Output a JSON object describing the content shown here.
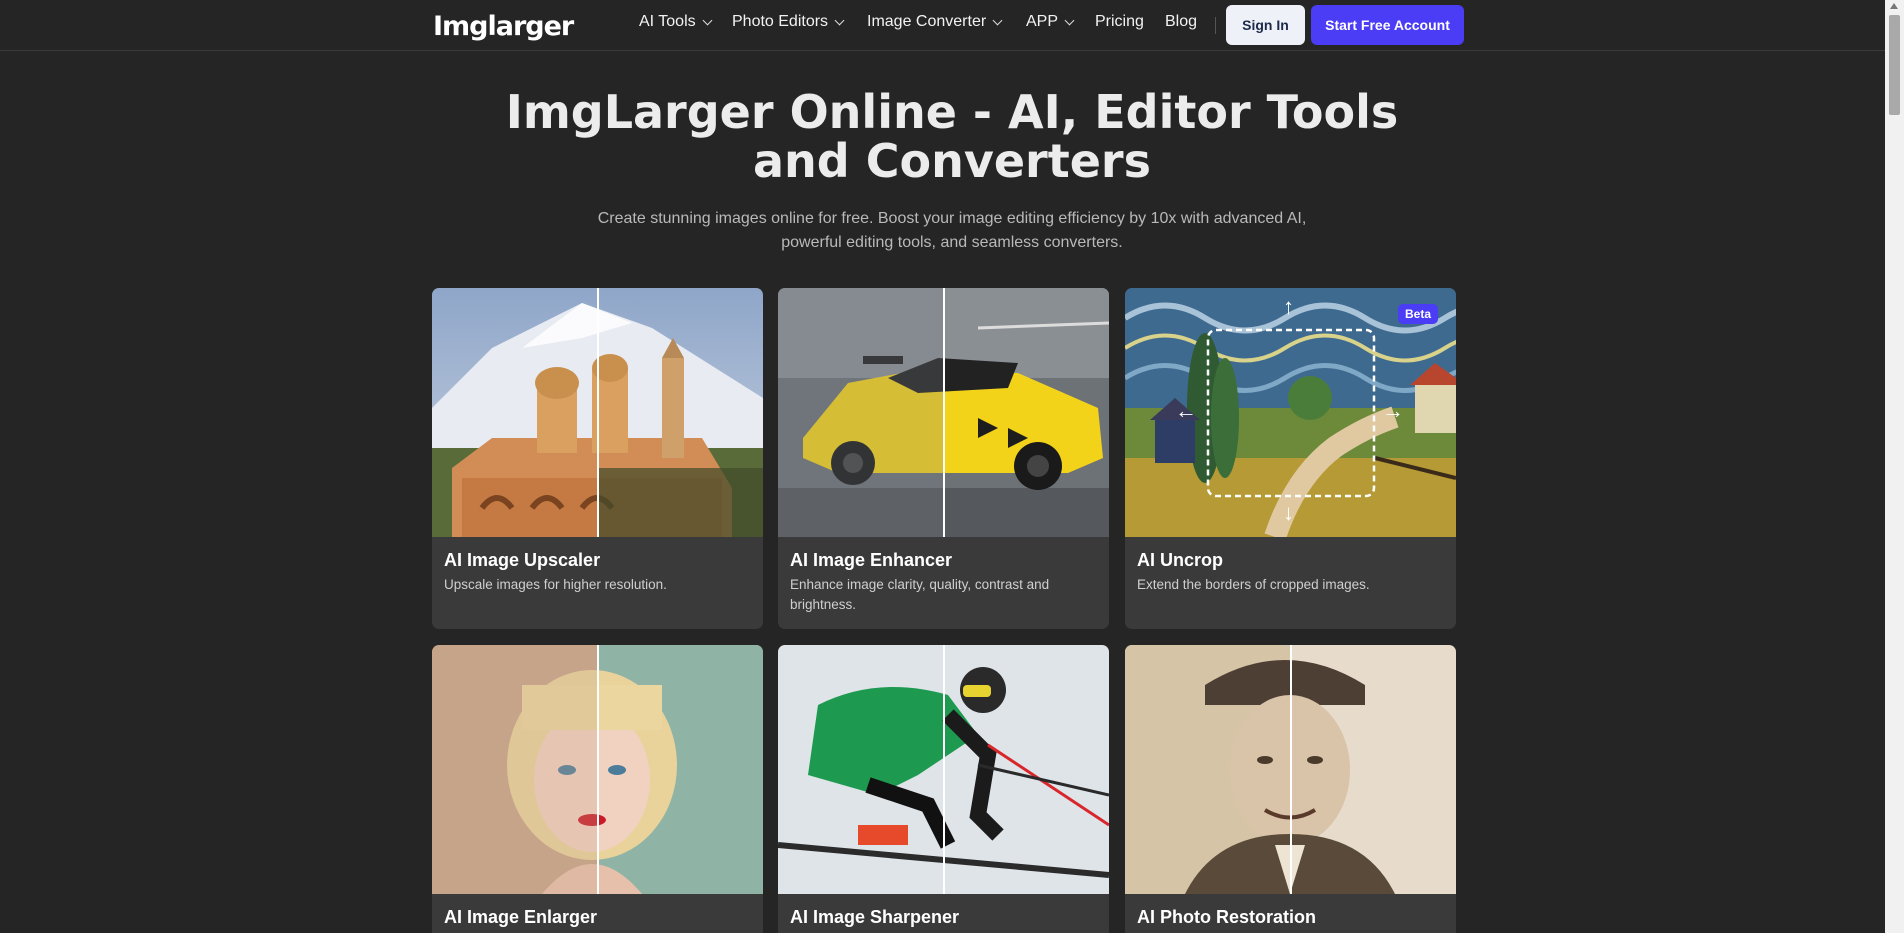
{
  "header": {
    "logo": "Imglarger",
    "nav": [
      {
        "label": "AI Tools",
        "dropdown": true
      },
      {
        "label": "Photo Editors",
        "dropdown": true
      },
      {
        "label": "Image Converter",
        "dropdown": true
      },
      {
        "label": "APP",
        "dropdown": true
      },
      {
        "label": "Pricing",
        "dropdown": false
      },
      {
        "label": "Blog",
        "dropdown": false
      }
    ],
    "sign_in": "Sign In",
    "start_free": "Start Free Account"
  },
  "hero": {
    "title_line1": "ImgLarger Online - AI, Editor Tools",
    "title_line2": "and Converters",
    "subtitle_line1": "Create stunning images online for free. Boost your image editing efficiency by 10x with advanced AI,",
    "subtitle_line2": "powerful editing tools, and seamless converters."
  },
  "cards": [
    {
      "title": "AI Image Upscaler",
      "desc": "Upscale images for higher resolution."
    },
    {
      "title": "AI Image Enhancer",
      "desc": "Enhance image clarity, quality, contrast and brightness."
    },
    {
      "title": "AI Uncrop",
      "desc": "Extend the borders of cropped images.",
      "badge": "Beta"
    },
    {
      "title": "AI Image Enlarger",
      "desc": ""
    },
    {
      "title": "AI Image Sharpener",
      "desc": ""
    },
    {
      "title": "AI Photo Restoration",
      "desc": ""
    }
  ],
  "colors": {
    "background": "#252525",
    "card": "#3a3a3a",
    "accent": "#4b3cf5",
    "sign_in_bg": "#eef1f8"
  },
  "icons": {
    "chevron": "chevron-down-icon",
    "uncrop_arrows": [
      "arrow-up-icon",
      "arrow-down-icon",
      "arrow-left-icon",
      "arrow-right-icon"
    ]
  }
}
